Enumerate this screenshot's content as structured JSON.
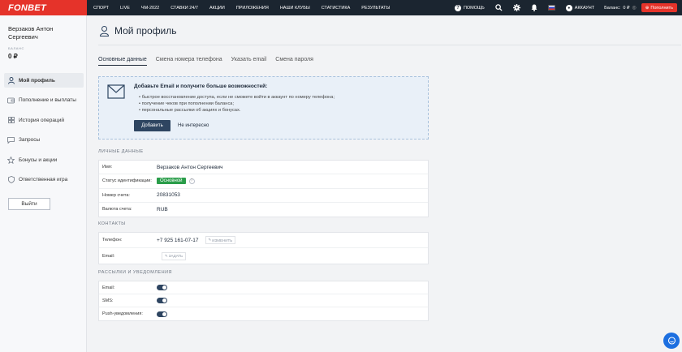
{
  "header": {
    "logo": "FONBET",
    "nav": [
      "СПОРТ",
      "LIVE",
      "ЧМ-2022",
      "СТАВКИ 24/7",
      "АКЦИИ",
      "ПРИЛОЖЕНИЯ",
      "НАШИ КЛУБЫ",
      "СТАТИСТИКА",
      "РЕЗУЛЬТАТЫ"
    ],
    "help": "ПОМОЩЬ",
    "account": "АККАУНТ",
    "balance_label": "Баланс:",
    "balance_value": "0 ₽",
    "deposit": "Пополнить"
  },
  "sidebar": {
    "user_name": "Верзаков Антон Сергеевич",
    "balance_label": "БАЛАНС",
    "balance_value": "0 ₽",
    "items": [
      {
        "label": "Мой профиль",
        "icon": "user-icon",
        "active": true
      },
      {
        "label": "Пополнение и выплаты",
        "icon": "wallet-icon"
      },
      {
        "label": "История операций",
        "icon": "grid-icon"
      },
      {
        "label": "Запросы",
        "icon": "chat-icon"
      },
      {
        "label": "Бонусы и акции",
        "icon": "star-icon"
      },
      {
        "label": "Ответственная игра",
        "icon": "shield-icon"
      }
    ],
    "logout": "Выйти"
  },
  "main": {
    "title": "Мой профиль",
    "tabs": [
      "Основные данные",
      "Смена номера телефона",
      "Указать email",
      "Смена пароля"
    ],
    "banner": {
      "title": "Добавьте Email и получите больше возможностей:",
      "items": [
        "• быстрое восстановление доступа, если не сможете войти в аккаунт по номеру телефона;",
        "• получение чеков при пополнении баланса;",
        "• персональные рассылки об акциях и бонусах."
      ],
      "add": "Добавить",
      "dismiss": "Не интересно"
    },
    "personal": {
      "heading": "ЛИЧНЫЕ ДАННЫЕ",
      "rows": [
        {
          "label": "Имя:",
          "value": "Верзаков Антон Сергеевич"
        },
        {
          "label": "Статус идентификации:",
          "value": "Основной"
        },
        {
          "label": "Номер счета:",
          "value": "20831053"
        },
        {
          "label": "Валюта счета:",
          "value": "RUB"
        }
      ]
    },
    "contacts": {
      "heading": "КОНТАКТЫ",
      "phone_label": "Телефон:",
      "phone_value": "+7 925 161-07-17",
      "phone_action": "ИЗМЕНИТЬ",
      "email_label": "Email:",
      "email_action": "ЗАДАТЬ"
    },
    "notifications": {
      "heading": "РАССЫЛКИ И УВЕДОМЛЕНИЯ",
      "rows": [
        {
          "label": "Email:",
          "enabled": true
        },
        {
          "label": "SMS:",
          "enabled": true
        },
        {
          "label": "Push-уведомления:",
          "enabled": true
        }
      ]
    }
  }
}
